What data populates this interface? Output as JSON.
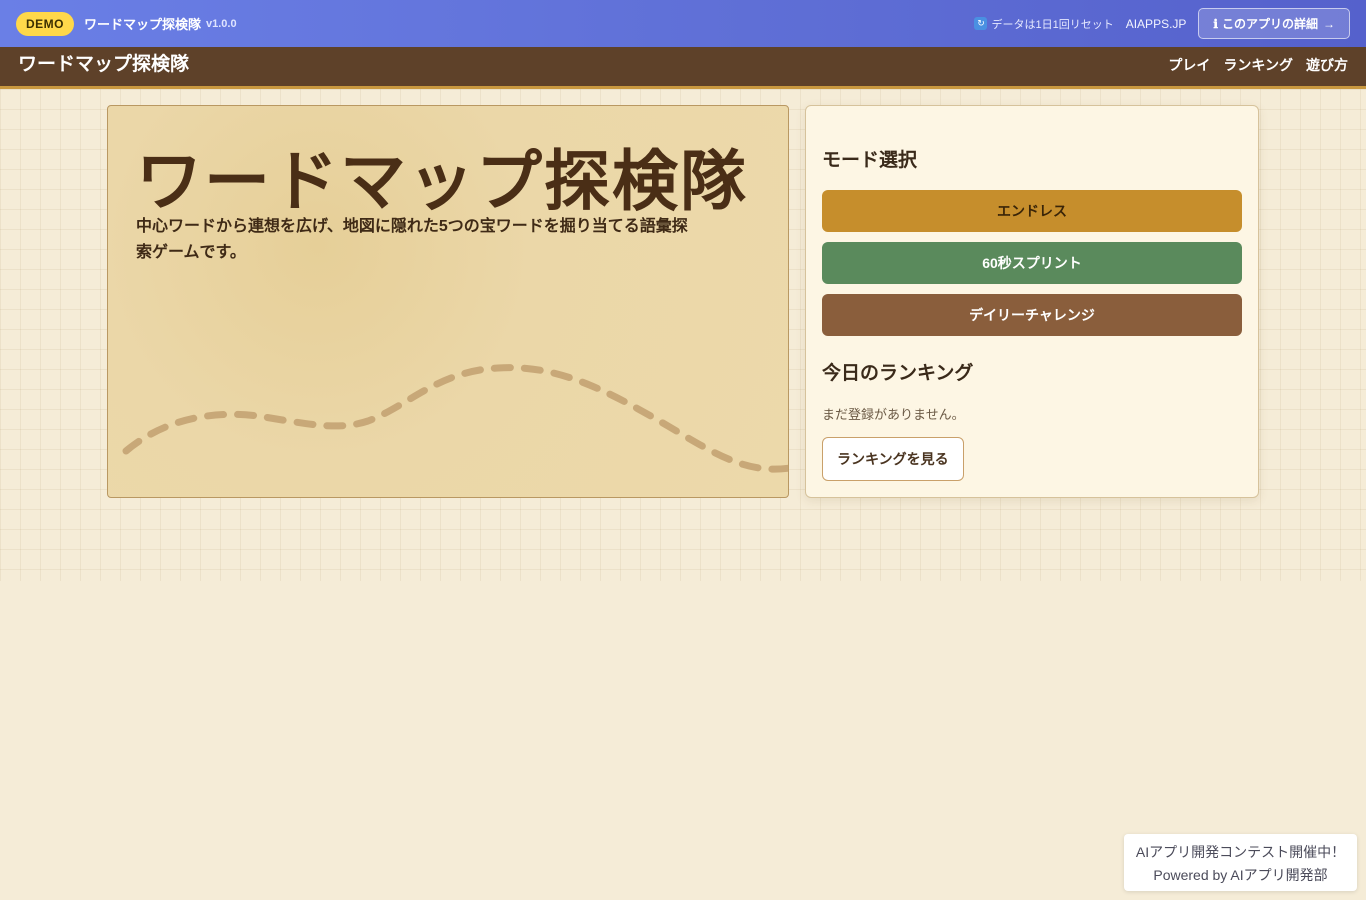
{
  "demo_bar": {
    "badge": "DEMO",
    "app_name": "ワードマップ探検隊",
    "version": "v1.0.0",
    "reset_note": "データは1日1回リセット",
    "reset_icon": "refresh-icon",
    "site_link": "AIAPPS.JP",
    "detail_button": "このアプリの詳細",
    "detail_arrow": "→",
    "info_icon": "info-icon"
  },
  "nav": {
    "site_title": "ワードマップ探検隊",
    "links": [
      "プレイ",
      "ランキング",
      "遊び方"
    ]
  },
  "hero": {
    "title": "ワードマップ探検隊",
    "description": "中心ワードから連想を広げ、地図に隠れた5つの宝ワードを掘り当てる語彙探索ゲームです。"
  },
  "panel": {
    "mode_heading": "モード選択",
    "modes": [
      "エンドレス",
      "60秒スプリント",
      "デイリーチャレンジ"
    ],
    "ranking_heading": "今日のランキング",
    "empty_note": "まだ登録がありません。",
    "ranking_button": "ランキングを見る"
  },
  "promo": {
    "line1": "AIアプリ開発コンテスト開催中！",
    "line2": "Powered by AIアプリ開発部"
  },
  "colors": {
    "demo_bar": "#5f6fd6",
    "nav_bg": "#5e4129",
    "endless": "#c68e2c",
    "sprint": "#5a8a5c",
    "daily": "#8a5e3c"
  }
}
